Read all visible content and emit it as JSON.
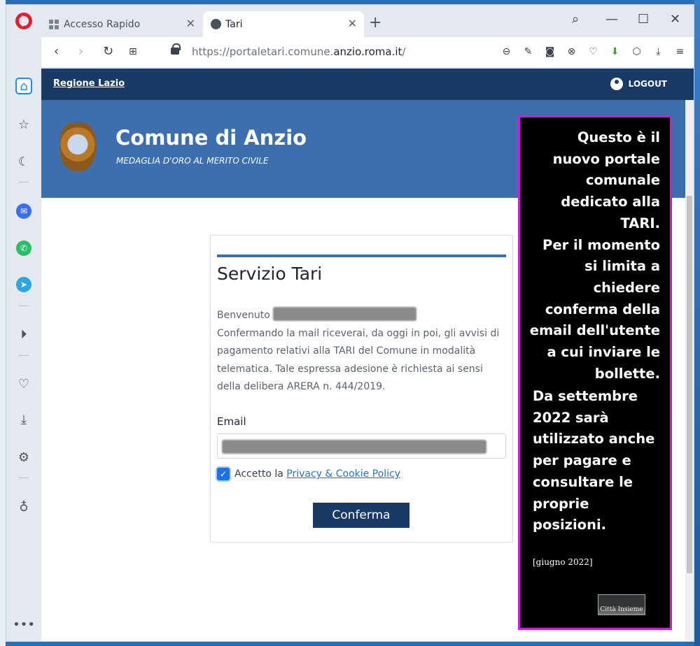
{
  "browser": {
    "tabs": [
      {
        "label": "Accesso Rapido",
        "active": false
      },
      {
        "label": "Tari",
        "active": true
      }
    ],
    "new_tab_symbol": "+",
    "url_prefix": "https://portaletari.comune.",
    "url_domain": "anzio.roma.it",
    "url_suffix": "/",
    "accent_color": "#1a8cff"
  },
  "site": {
    "region_link": "Regione Lazio",
    "logout_label": "LOGOUT",
    "title": "Comune di Anzio",
    "subtitle": "MEDAGLIA D'ORO AL MERITO CIVILE",
    "header_color": "#3d6fae",
    "topbar_color": "#1a3a66"
  },
  "card": {
    "title": "Servizio Tari",
    "welcome": "Benvenuto",
    "body": "Confermando la mail riceverai, da oggi in poi, gli avvisi di pagamento relativi alla TARI del Comune in modalità telematica. Tale espressa adesione è richiesta ai sensi della delibera ARERA n. 444/2019.",
    "email_label": "Email",
    "accept_prefix": "Accetto la",
    "privacy_link": "Privacy & Cookie Policy",
    "checkbox_checked": true,
    "confirm_button": "Conferma"
  },
  "annotation": {
    "main_text": "Questo è il\nnuovo portale\ncomunale\ndedicato alla\nTARI. \nPer il momento\nsi limita  a\nchiedere\nconferma della\nemail dell'utente\na cui inviare le\nbollette.",
    "bottom_text": "Da settembre\n2022 sarà\nutilizzato anche\nper pagare e\nconsultare le\nproprie\nposizioni.",
    "date": "[giugno 2022]",
    "logo_text": "Città Insieme",
    "border_color": "#d11ad6"
  }
}
